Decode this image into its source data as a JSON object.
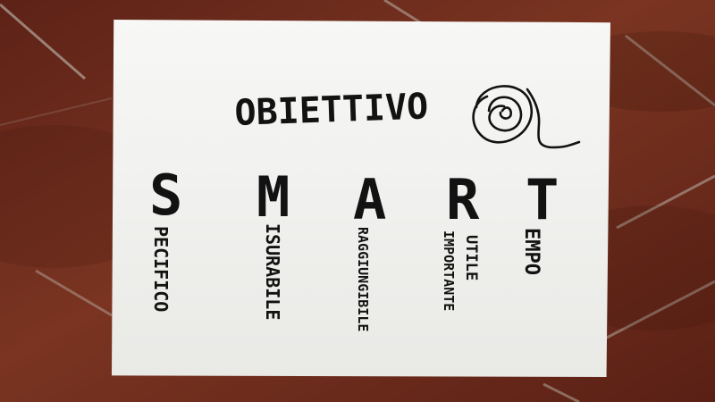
{
  "title": "OBIETTIVO",
  "smart": {
    "s": "S",
    "m": "M",
    "a": "A",
    "r": "R",
    "t": "T"
  },
  "words": {
    "specifico": "PECIFICO",
    "misurabile": "ISURABILE",
    "raggiungibile": "RAGGIUNGIBILE",
    "importante": "IMPORTANTE",
    "utile": "UTILE",
    "tempo": "EMPO"
  },
  "colors": {
    "floor": "#6a2a1c",
    "paper": "#f3f3f1",
    "ink": "#121212"
  },
  "icon": "target-icon"
}
